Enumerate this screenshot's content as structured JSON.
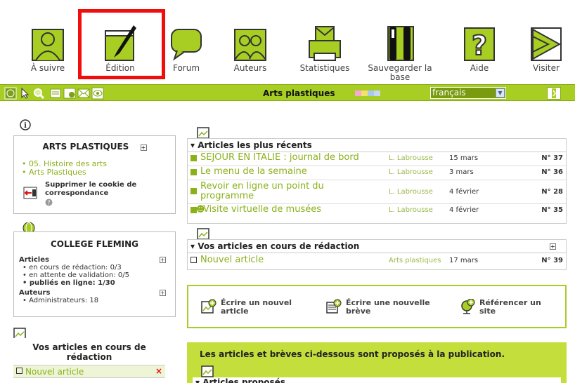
{
  "nav": {
    "items": [
      {
        "label": "À suivre",
        "icon": "user-icon"
      },
      {
        "label": "Édition",
        "icon": "pen-icon"
      },
      {
        "label": "Forum",
        "icon": "speech-bubble-icon"
      },
      {
        "label": "Auteurs",
        "icon": "users-icon"
      },
      {
        "label": "Statistiques",
        "icon": "printer-stats-icon"
      },
      {
        "label": "Sauvegarder la base",
        "icon": "tools-icon"
      },
      {
        "label": "Aide",
        "icon": "question-icon"
      },
      {
        "label": "Visiter",
        "icon": "arrow-visit-icon"
      }
    ]
  },
  "toolbar": {
    "title": "Arts plastiques",
    "language": "français",
    "swatch_colors": [
      "#f7a8d8",
      "#f0e26a",
      "#a8c8f0",
      "#c8d8f0"
    ]
  },
  "colors": {
    "accent": "#a8ce24",
    "link": "#8ab11a",
    "highlight": "#f20d0d"
  },
  "left": {
    "arts_box": {
      "title": "ARTS PLASTIQUES",
      "links": [
        "05. Histoire des arts",
        "Arts Plastiques"
      ],
      "cookie_label": "Supprimer le cookie de correspondance"
    },
    "college_box": {
      "title": "COLLEGE FLEMING",
      "articles_label": "Articles",
      "articles_items": [
        "en cours de rédaction: 0/3",
        "en attente de validation: 0/5",
        "publiés en ligne: 1/30"
      ],
      "authors_label": "Auteurs",
      "authors_items": [
        "Administrateurs: 18"
      ]
    },
    "drafts_box": {
      "title": "Vos articles en cours de rédaction",
      "item": "Nouvel article"
    }
  },
  "recent": {
    "title": "Articles les plus récents",
    "rows": [
      {
        "title": "SEJOUR EN ITALIE : journal de bord",
        "author": "L. Labrousse",
        "date": "15 mars",
        "num": "N° 37"
      },
      {
        "title": "Le menu de la semaine",
        "author": "L. Labrousse",
        "date": "3 mars",
        "num": "N° 36"
      },
      {
        "title": "Revoir en ligne un point du programme",
        "author": "L. Labrousse",
        "date": "4 février",
        "num": "N° 28"
      },
      {
        "title": "Visite virtuelle de musées",
        "author": "L. Labrousse",
        "date": "4 février",
        "num": "N° 35"
      }
    ]
  },
  "drafts": {
    "title": "Vos articles en cours de rédaction",
    "rows": [
      {
        "title": "Nouvel article",
        "section": "Arts plastiques",
        "date": "17 mars",
        "num": "N° 39"
      }
    ]
  },
  "actions": {
    "write_article": "Écrire un nouvel article",
    "write_breve": "Écrire une nouvelle brève",
    "reference_site": "Référencer un site"
  },
  "proposed": {
    "text": "Les articles et brèves ci-dessous sont proposés à la publication.",
    "subtitle": "Articles proposés"
  }
}
